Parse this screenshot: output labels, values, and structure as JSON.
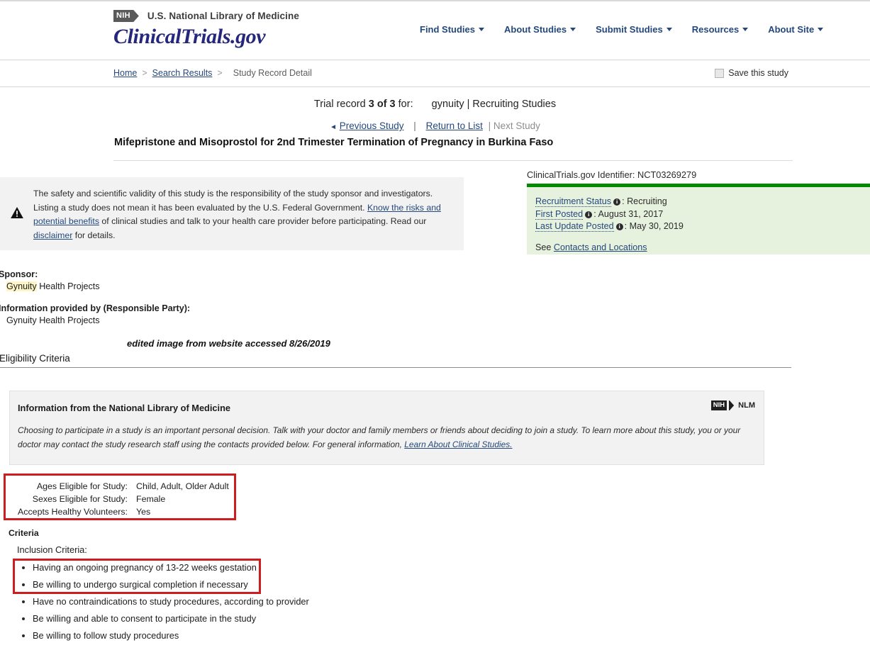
{
  "masthead": {
    "nih_logo_text": "NIH",
    "agency": "U.S. National Library of Medicine",
    "wordmark": "ClinicalTrials.gov",
    "nav": [
      {
        "label": "Find Studies"
      },
      {
        "label": "About Studies"
      },
      {
        "label": "Submit Studies"
      },
      {
        "label": "Resources"
      },
      {
        "label": "About Site"
      }
    ]
  },
  "breadcrumb": {
    "home": "Home",
    "sep1": ">",
    "search_results": "Search Results",
    "sep2": ">",
    "current": "Study Record Detail",
    "save_label": "Save this study"
  },
  "record": {
    "prefix": "Trial record",
    "position": "3 of 3",
    "for_label": "for:",
    "query": "gynuity | Recruiting Studies",
    "previous": "Previous Study",
    "return_to_list": "Return to List",
    "next": "| Next Study",
    "pipe": "|",
    "arrow_left": "◄"
  },
  "study": {
    "title": "Mifepristone and Misoprostol for 2nd Trimester Termination of Pregnancy in Burkina Faso"
  },
  "disclaimer": {
    "part1": "The safety and scientific validity of this study is the responsibility of the study sponsor and investigators. Listing a study does not mean it has been evaluated by the U.S. Federal Government. ",
    "link1": "Know the risks and potential benefits",
    "part2": " of clinical studies and talk to your health care provider before participating. Read our ",
    "link2": "disclaimer",
    "part3": " for details."
  },
  "status": {
    "identifier_label": "ClinicalTrials.gov Identifier:",
    "identifier_value": "NCT03269279",
    "rows": [
      {
        "label": "Recruitment Status",
        "value": ": Recruiting"
      },
      {
        "label": "First Posted",
        "value": ": August 31, 2017"
      },
      {
        "label": "Last Update Posted",
        "value": ": May 30, 2019"
      }
    ],
    "see_prefix": "See",
    "see_link": "Contacts and Locations",
    "accent_color": "#028a02",
    "panel_color": "#e7f2de"
  },
  "sponsor": {
    "sponsor_label": "Sponsor:",
    "sponsor_highlight": "Gynuity",
    "sponsor_rest": " Health Projects",
    "responsible_label": "Information provided by (Responsible Party):",
    "responsible_value": "Gynuity Health Projects"
  },
  "annotation": {
    "text": "edited image from website accessed 8/26/2019"
  },
  "eligibility_section": {
    "heading": "Eligibility Criteria"
  },
  "nlm_box": {
    "title": "Information from the National Library of Medicine",
    "body_part1": "Choosing to participate in a study is an important personal decision. Talk with your doctor and family members or friends about deciding to join a study. To learn more about this study, you or your doctor may contact the study research staff using the contacts provided below. For general information, ",
    "body_link": "Learn About Clinical Studies.",
    "badge_nih": "NIH",
    "badge_nlm": "NLM"
  },
  "eligibility_table": {
    "rows": [
      {
        "key": "Ages Eligible for Study:",
        "value": "Child, Adult, Older Adult"
      },
      {
        "key": "Sexes Eligible for Study:",
        "value": "Female"
      },
      {
        "key": "Accepts Healthy Volunteers:",
        "value": "Yes"
      }
    ],
    "highlight_color": "#cc1e1e"
  },
  "criteria": {
    "heading": "Criteria",
    "inclusion_heading": "Inclusion Criteria:",
    "items": [
      "Having an ongoing pregnancy of 13-22 weeks gestation",
      "Be willing to undergo surgical completion if necessary",
      "Have no contraindications to study procedures, according to provider",
      "Be willing and able to consent to participate in the study",
      "Be willing to follow study procedures"
    ],
    "highlight_color": "#cc1e1e"
  }
}
